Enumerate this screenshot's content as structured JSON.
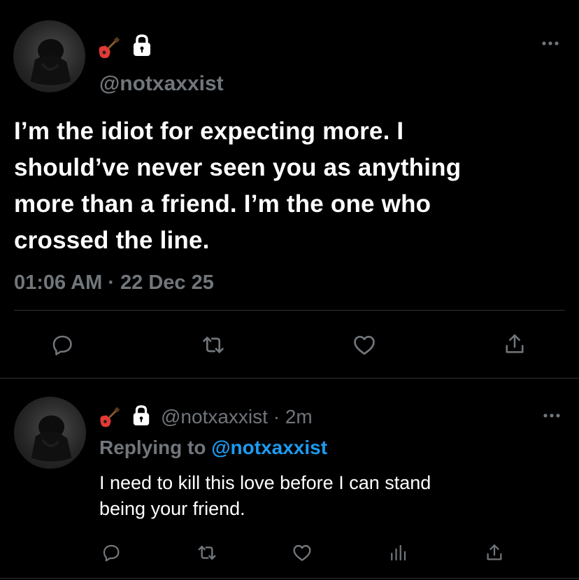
{
  "main_tweet": {
    "emojis": [
      "guitar-emoji",
      "lock-emoji"
    ],
    "handle": "@notxaxxist",
    "text_lines": [
      "I’m the idiot for expecting more. I",
      "should’ve never seen you as anything",
      "more than a friend. I’m the one who",
      "crossed the line."
    ],
    "timestamp": "01:06 AM · 22 Dec 25",
    "actions": [
      "reply-icon",
      "retweet-icon",
      "like-icon",
      "share-icon"
    ]
  },
  "reply_tweet": {
    "handle": "@notxaxxist",
    "separator": "·",
    "time_ago": "2m",
    "replying_prefix": "Replying to",
    "replying_to": "@notxaxxist",
    "text_lines": [
      "I need to kill this love before I can stand",
      "being your friend."
    ],
    "actions": [
      "reply-icon",
      "retweet-icon",
      "like-icon",
      "analytics-icon",
      "share-icon"
    ]
  },
  "colors": {
    "background": "#000000",
    "text": "#ffffff",
    "muted": "#71767b",
    "link": "#1d9bf0",
    "divider": "#2f3336"
  }
}
